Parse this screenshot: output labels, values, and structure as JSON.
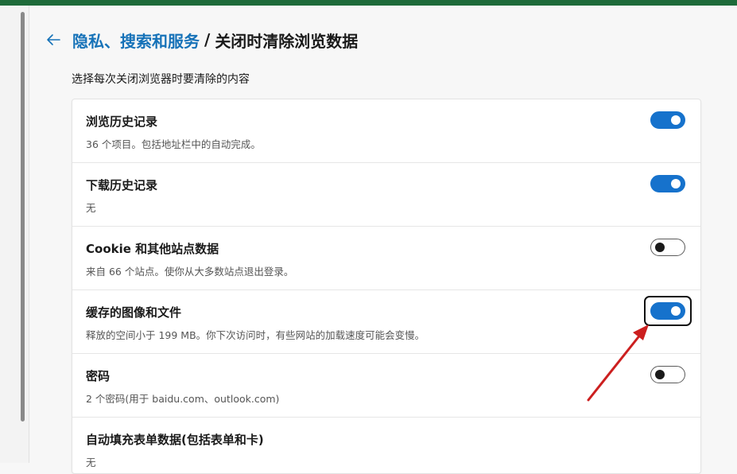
{
  "header": {
    "breadcrumb_parent": "隐私、搜索和服务",
    "separator": "/",
    "page_title": "关闭时清除浏览数据"
  },
  "subtitle": "选择每次关闭浏览器时要清除的内容",
  "items": [
    {
      "title": "浏览历史记录",
      "desc": "36 个项目。包括地址栏中的自动完成。",
      "enabled": true
    },
    {
      "title": "下载历史记录",
      "desc": "无",
      "enabled": true
    },
    {
      "title": "Cookie 和其他站点数据",
      "desc": "来自 66 个站点。使你从大多数站点退出登录。",
      "enabled": false
    },
    {
      "title": "缓存的图像和文件",
      "desc": "释放的空间小于 199 MB。你下次访问时，有些网站的加载速度可能会变慢。",
      "enabled": true,
      "focused": true
    },
    {
      "title": "密码",
      "desc": "2 个密码(用于 baidu.com、outlook.com)",
      "enabled": false
    },
    {
      "title": "自动填充表单数据(包括表单和卡)",
      "desc": "无",
      "enabled": false
    }
  ],
  "colors": {
    "accent": "#1672cc",
    "link": "#1672b8",
    "annotation_arrow": "#cc1f1f",
    "titlebar": "#1e6b3a"
  },
  "icons": {
    "back": "arrow-left-icon"
  }
}
